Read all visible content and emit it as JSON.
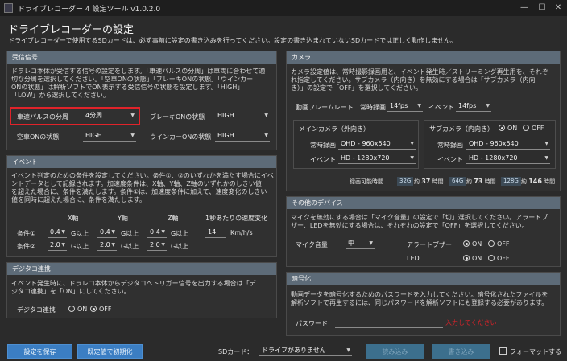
{
  "window": {
    "title": "ドライブレコーダー 4 設定ツール v1.0.2.0",
    "minimize": "—",
    "maximize": "☐",
    "close": "✕"
  },
  "page": {
    "title": "ドライブレコーダーの設定",
    "description": "ドライブレコーダーで使用するSDカードは、必ず事前に設定の書き込みを行ってください。設定の書き込まれていないSDカードでは正しく動作しません。"
  },
  "signal": {
    "header": "受信信号",
    "desc_lines": [
      "ドラレコ本体が受信する信号の設定をします。「車速パルスの分周」は車両に合わせて適",
      "切な分周を選択してください。「空車ONの状態」「ブレーキONの状態」「ウインカー",
      "ONの状態」は解析ソフトでON表示する受信信号の状態を設定します。「HIGH」",
      "「LOW」から選択してください。"
    ],
    "pulse_label": "車速パルスの分周",
    "pulse_value": "4分周",
    "brake_label": "ブレーキONの状態",
    "brake_value": "HIGH",
    "empty_label": "空車ONの状態",
    "empty_value": "HIGH",
    "winker_label": "ウインカーONの状態",
    "winker_value": "HIGH"
  },
  "event": {
    "header": "イベント",
    "desc_lines": [
      "イベント判定のための条件を設定してください。条件①、②のいずれかを満たす場合にイベ",
      "ントデータとして記録されます。加速度条件は、X軸、Y軸、Z軸のいずれかのしきい値",
      "を超えた場合に、条件を満たします。条件①は、加速度条件に加えて、速度変化のしきい",
      "値を同時に超えた場合に、条件を満たします。"
    ],
    "col_x": "X軸",
    "col_y": "Y軸",
    "col_z": "Z軸",
    "col_speed": "1秒あたりの速度変化",
    "rows": [
      {
        "label": "条件①",
        "x": "0.4",
        "y": "0.4",
        "z": "0.4",
        "unit": "G以上",
        "speed": "14",
        "speed_unit": "Km/h/s"
      },
      {
        "label": "条件②",
        "x": "2.0",
        "y": "2.0",
        "z": "2.0",
        "unit": "G以上"
      }
    ]
  },
  "digitacho": {
    "header": "デジタコ連携",
    "desc_lines": [
      "イベント発生時に、ドラレコ本体からデジタコへトリガー信号を出力する場合は「デ",
      "ジタコ連携」を「ON」にしてください。"
    ],
    "label": "デジタコ連携",
    "on": "ON",
    "off": "OFF",
    "selected": "OFF"
  },
  "camera": {
    "header": "カメラ",
    "desc_lines": [
      "カメラ設定値は、常時撮影録画用と、イベント発生時／ストリーミング再生用を、それぞ",
      "れ指定してください。サブカメラ（内向き）を無効にする場合は「サブカメラ（内向",
      "き）」の設定で「OFF」を選択してください。"
    ],
    "fps_label": "動画フレームレート",
    "always_label": "常時録画",
    "always_fps": "14fps",
    "event_label": "イベント",
    "event_fps": "14fps",
    "main_title": "メインカメラ（外向き）",
    "main_always_label": "常時録画",
    "main_always": "QHD - 960x540",
    "main_event_label": "イベント",
    "main_event": "HD - 1280x720",
    "sub_title": "サブカメラ（内向き）",
    "sub_on": "ON",
    "sub_off": "OFF",
    "sub_always_label": "常時録画",
    "sub_always": "QHD - 960x540",
    "sub_event_label": "イベント",
    "sub_event": "HD - 1280x720",
    "rec_time_label": "録画可能時間",
    "rec": [
      {
        "cap": "32G",
        "approx": "約",
        "hours": "37",
        "unit": "時間"
      },
      {
        "cap": "64G",
        "approx": "約",
        "hours": "73",
        "unit": "時間"
      },
      {
        "cap": "128G",
        "approx": "約",
        "hours": "146",
        "unit": "時間"
      }
    ]
  },
  "devices": {
    "header": "その他のデバイス",
    "desc_lines": [
      "マイクを無効にする場合は「マイク音量」の設定で「切」選択してください。アラートブ",
      "ザー、LEDを無効にする場合は、それぞれの設定で「OFF」を選択してください。"
    ],
    "mic_label": "マイク音量",
    "mic_value": "中",
    "buzzer_label": "アラートブザー",
    "led_label": "LED",
    "on": "ON",
    "off": "OFF"
  },
  "crypto": {
    "header": "暗号化",
    "desc_lines": [
      "動画データを暗号化するためのパスワードを入力してください。暗号化されたファイルを",
      "解析ソフトで再生するには、同じパスワードを解析ソフトにも登録する必要があります。"
    ],
    "password_label": "パスワード",
    "password_error": "入力してください"
  },
  "footer": {
    "save": "設定を保存",
    "reset": "既定値で初期化",
    "sd_label": "SDカード：",
    "sd_value": "ドライブがありません",
    "read": "読み込み",
    "write": "書き込み",
    "format": "フォーマットする"
  },
  "colors": {
    "panel_header": "#5d6b78",
    "accent_button": "#3b7ec3",
    "highlight": "#e0232a",
    "error": "#d2232a"
  }
}
